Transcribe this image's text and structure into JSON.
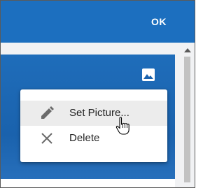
{
  "header": {
    "ok_label": "OK"
  },
  "card": {
    "picture_icon": "image-icon"
  },
  "menu": {
    "items": [
      {
        "label": "Set Picture...",
        "icon": "pencil-icon",
        "hovered": true
      },
      {
        "label": "Delete",
        "icon": "close-icon",
        "hovered": false
      }
    ]
  },
  "cursor": {
    "type": "hand-pointer"
  },
  "colors": {
    "header_bg": "#1c6fbf",
    "card_bg": "#1a62ad",
    "menu_hover_bg": "#ececec",
    "text": "#222222"
  }
}
